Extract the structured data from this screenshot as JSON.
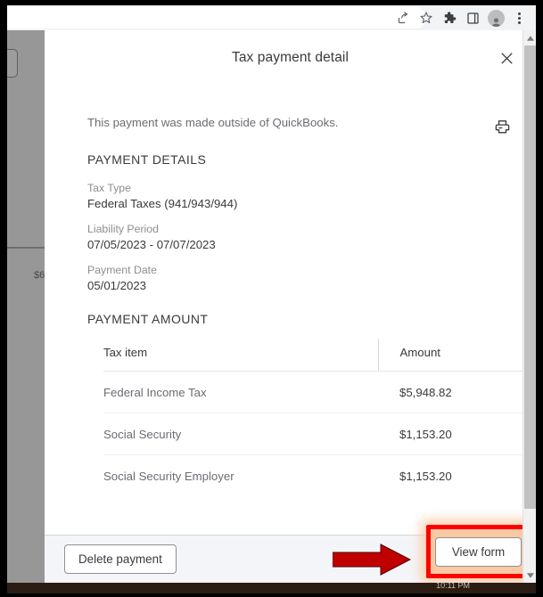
{
  "browser": {
    "toolbar_icons": [
      {
        "name": "share-icon",
        "label": "Share this page"
      },
      {
        "name": "bookmark-star-icon",
        "label": "Bookmark this tab"
      },
      {
        "name": "extensions-puzzle-icon",
        "label": "Extensions"
      },
      {
        "name": "side-panel-icon",
        "label": "Side panel"
      },
      {
        "name": "profile-avatar-icon",
        "label": "Profile"
      },
      {
        "name": "three-dot-menu-icon",
        "label": "Customize and control"
      }
    ]
  },
  "backdrop": {
    "partial_amount": "$6"
  },
  "modal": {
    "title": "Tax payment detail",
    "close_label": "×",
    "print_label": "Print",
    "outside_note": "This payment was made outside of QuickBooks.",
    "details": {
      "heading": "PAYMENT DETAILS",
      "fields": [
        {
          "label": "Tax Type",
          "value": "Federal Taxes (941/943/944)"
        },
        {
          "label": "Liability Period",
          "value": "07/05/2023 - 07/07/2023"
        },
        {
          "label": "Payment Date",
          "value": "05/01/2023"
        }
      ]
    },
    "amount": {
      "heading": "PAYMENT AMOUNT",
      "columns": [
        "Tax item",
        "Amount"
      ],
      "rows": [
        {
          "item": "Federal Income Tax",
          "amount": "$5,948.82"
        },
        {
          "item": "Social Security",
          "amount": "$1,153.20"
        },
        {
          "item": "Social Security Employer",
          "amount": "$1,153.20"
        }
      ]
    },
    "footer": {
      "delete_label": "Delete payment",
      "view_form_label": "View form"
    }
  },
  "annotation": {
    "arrow_color": "#c00000",
    "highlight_border_color": "#ff0000",
    "highlight_fill_color": "#f9c9a3"
  },
  "taskbar": {
    "clock": "10:11 PM"
  }
}
